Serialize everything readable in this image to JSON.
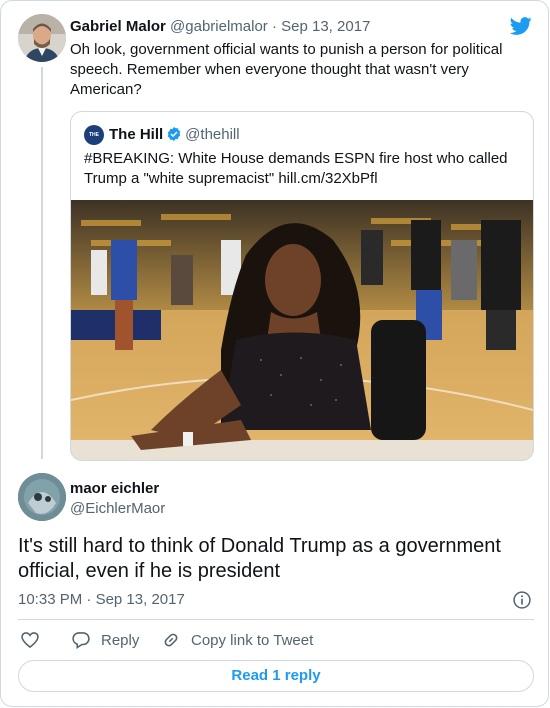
{
  "parent_tweet": {
    "name": "Gabriel Malor",
    "handle": "@gabrielmalor",
    "separator": "·",
    "date": "Sep 13, 2017",
    "text": "Oh look, government official wants to punish a person for political speech. Remember when everyone thought that wasn't very American?"
  },
  "quoted_tweet": {
    "avatar_text": "THE HILL",
    "name": "The Hill",
    "handle": "@thehill",
    "text": "#BREAKING: White House demands ESPN fire host who called Trump a \"white supremacist\" hill.cm/32XbPfl"
  },
  "main_tweet": {
    "name": "maor eichler",
    "handle": "@EichlerMaor",
    "text": "It's still hard to think of Donald Trump as a government official, even if he is president",
    "time": "10:33 PM",
    "separator": "·",
    "date": "Sep 13, 2017"
  },
  "actions": {
    "reply_label": "Reply",
    "copy_link_label": "Copy link to Tweet"
  },
  "read_replies_label": "Read 1 reply",
  "colors": {
    "accent": "#1d9bf0",
    "secondary_text": "#536471",
    "border": "#cfd9de"
  },
  "icons": [
    "twitter-logo-icon",
    "verified-badge-icon",
    "info-icon",
    "heart-icon",
    "reply-icon",
    "link-icon"
  ]
}
